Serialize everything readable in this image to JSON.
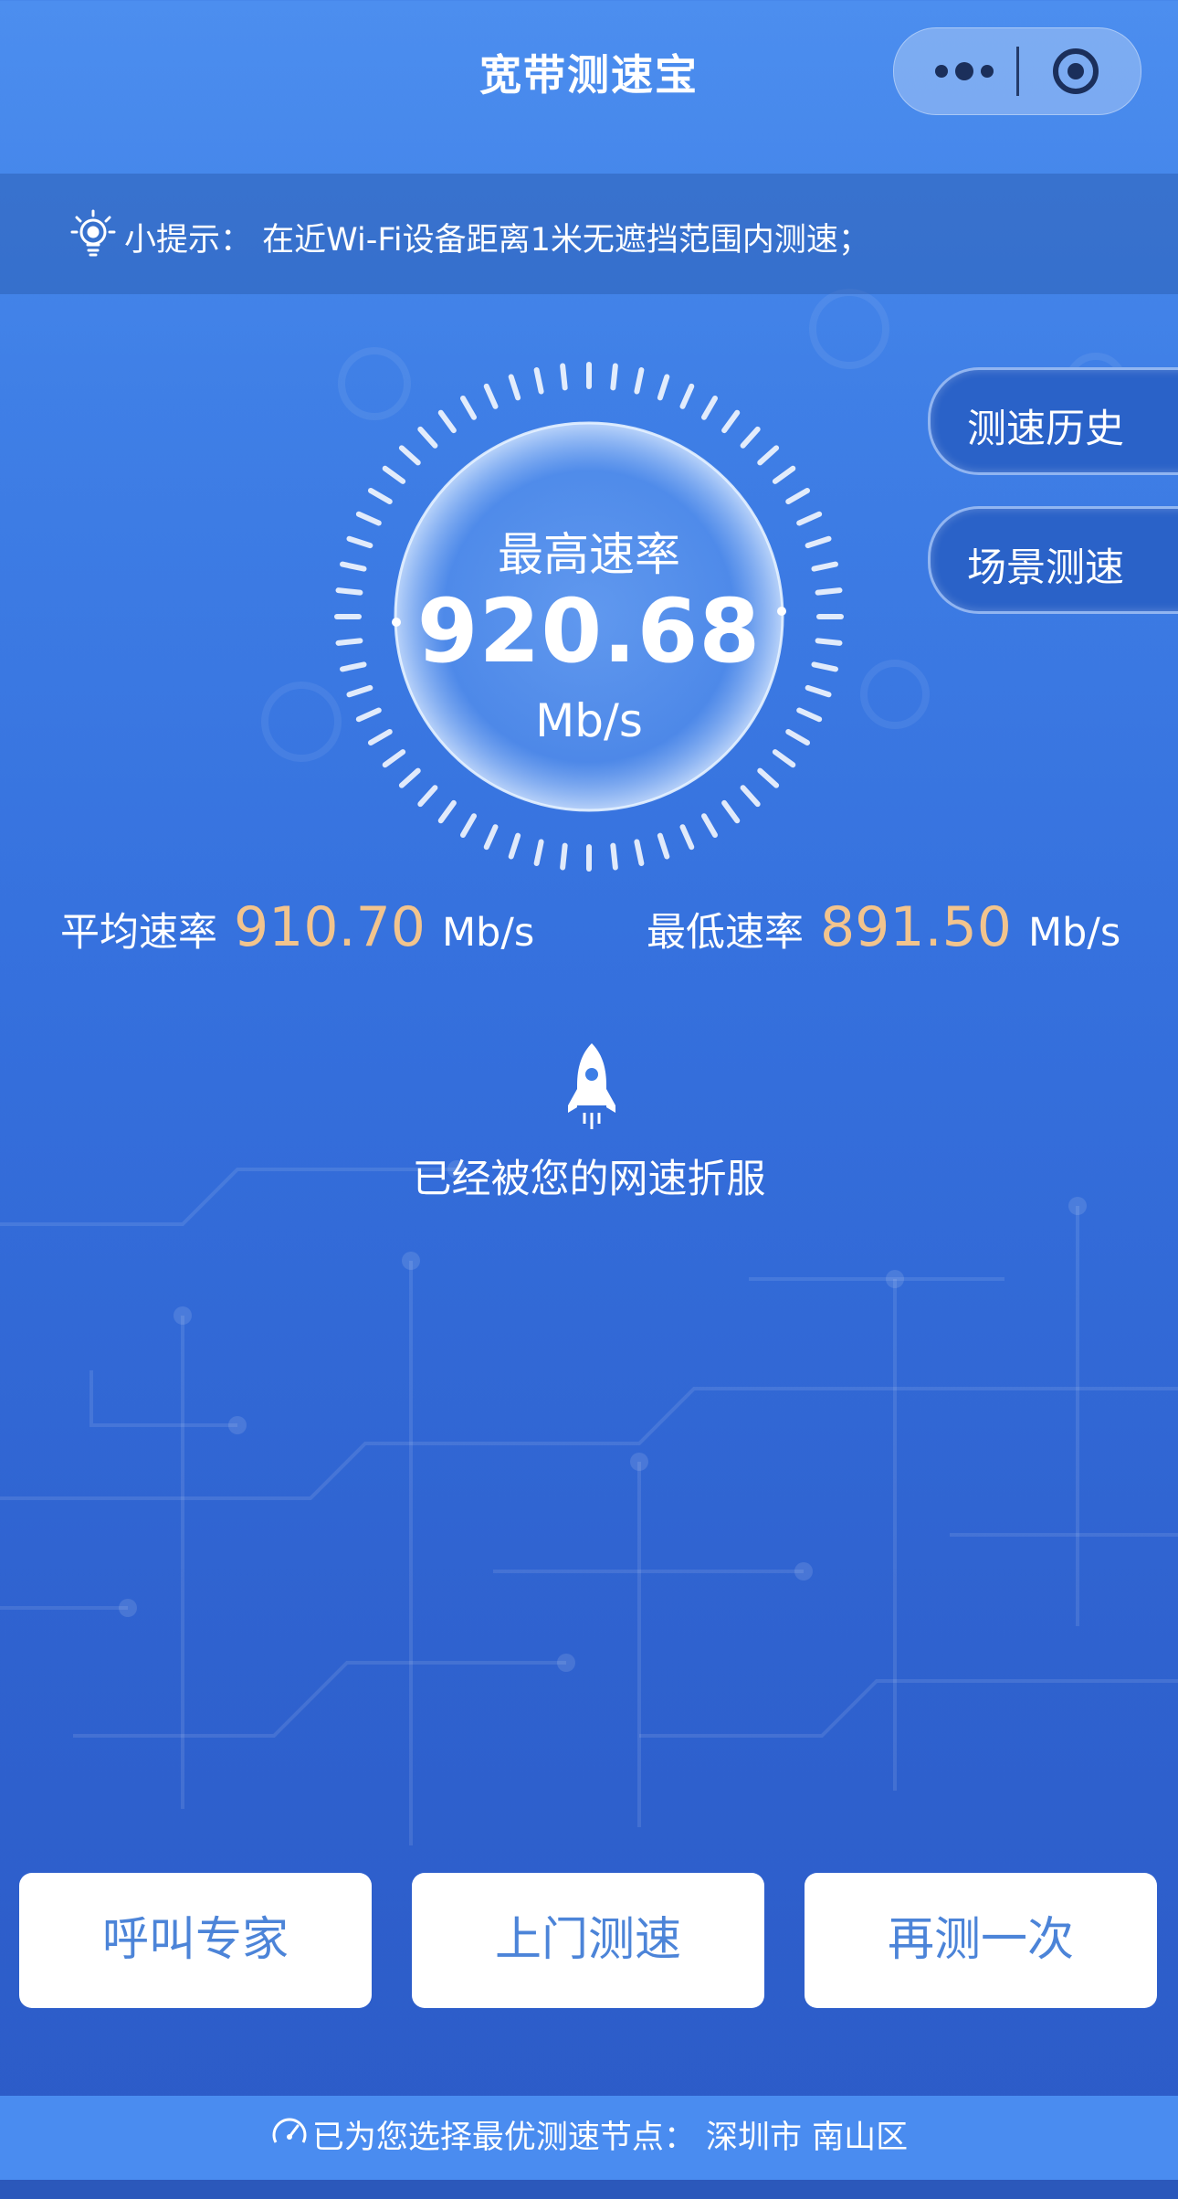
{
  "header": {
    "title": "宽带测速宝"
  },
  "capsule": {
    "more_icon": "more-dots-icon",
    "close_icon": "target-close-icon"
  },
  "tip": {
    "icon": "lightbulb-icon",
    "text": "小提示：  在近Wi-Fi设备距离1米无遮挡范围内测速；"
  },
  "side_buttons": [
    {
      "label": "测速历史"
    },
    {
      "label": "场景测速"
    }
  ],
  "gauge": {
    "label": "最高速率",
    "value": "920.68",
    "unit": "Mb/s"
  },
  "stats": {
    "average": {
      "label": "平均速率",
      "value": "910.70",
      "unit": "Mb/s"
    },
    "minimum": {
      "label": "最低速率",
      "value": "891.50",
      "unit": "Mb/s"
    }
  },
  "result": {
    "icon": "rocket-icon",
    "message": "已经被您的网速折服"
  },
  "actions": [
    {
      "label": "呼叫专家"
    },
    {
      "label": "上门测速"
    },
    {
      "label": "再测一次"
    }
  ],
  "footer": {
    "icon": "speedometer-icon",
    "text": "已为您选择最优测速节点：  深圳市  南山区"
  },
  "colors": {
    "accent_value": "#f2c48d",
    "button_text": "#4c84d8",
    "footer_bg": "#4a8cf0"
  }
}
